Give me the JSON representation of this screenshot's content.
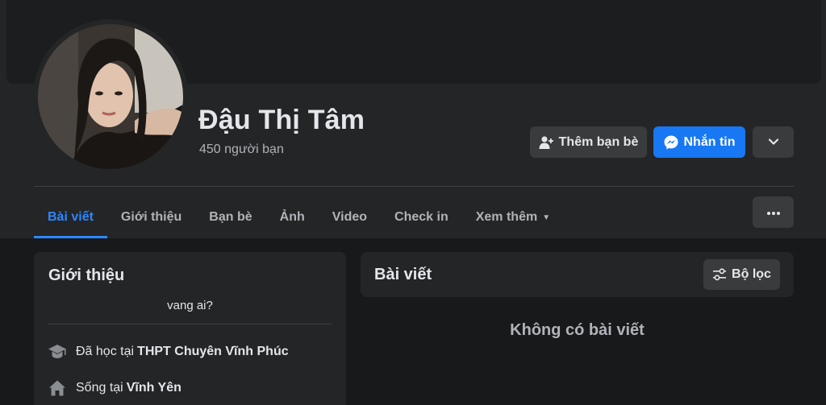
{
  "profile": {
    "name": "Đậu Thị Tâm",
    "friend_count": "450 người bạn"
  },
  "actions": {
    "add_friend_label": "Thêm bạn bè",
    "message_label": "Nhắn tin"
  },
  "tabs": [
    {
      "label": "Bài viết",
      "active": true
    },
    {
      "label": "Giới thiệu"
    },
    {
      "label": "Bạn bè"
    },
    {
      "label": "Ảnh"
    },
    {
      "label": "Video"
    },
    {
      "label": "Check in"
    },
    {
      "label": "Xem thêm",
      "has_dropdown": true
    }
  ],
  "intro": {
    "title": "Giới thiệu",
    "bio": "vang ai?",
    "education_prefix": "Đã học tại",
    "education_value": "THPT Chuyên Vĩnh Phúc",
    "lives_prefix": "Sống tại",
    "lives_value": "Vĩnh Yên"
  },
  "posts": {
    "title": "Bài viết",
    "filter_label": "Bộ lọc",
    "empty_text": "Không có bài viết"
  },
  "colors": {
    "background": "#18191a",
    "card": "#242526",
    "button": "#3a3b3c",
    "accent": "#2d88ff",
    "messenger_button": "#1877f2",
    "text_primary": "#e4e6eb",
    "text_secondary": "#b0b3b8"
  },
  "icons": {
    "add_friend": "person-plus-icon",
    "message": "messenger-icon",
    "more": "chevron-down-icon",
    "tab_more": "ellipsis-icon",
    "filter": "sliders-icon",
    "education": "graduation-cap-icon",
    "home": "home-icon"
  }
}
